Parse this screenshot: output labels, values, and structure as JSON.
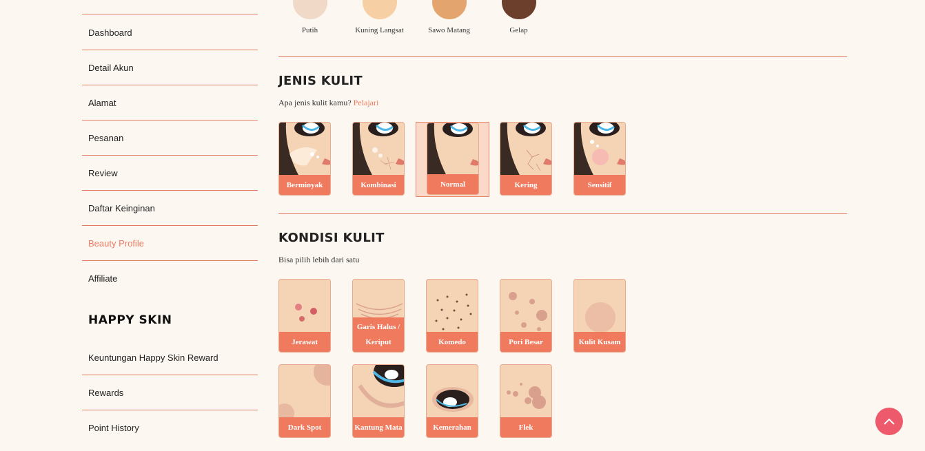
{
  "sidebar": {
    "items": [
      "Dashboard",
      "Detail Akun",
      "Alamat",
      "Pesanan",
      "Review",
      "Daftar Keinginan",
      "Beauty Profile",
      "Affiliate"
    ],
    "active": "Beauty Profile",
    "happy_skin": {
      "heading": "HAPPY SKIN",
      "items": [
        "Keuntungan Happy Skin Reward",
        "Rewards",
        "Point History"
      ]
    }
  },
  "skin_tone": {
    "options": [
      {
        "label": "Putih",
        "color": "#f0d9c6"
      },
      {
        "label": "Kuning Langsat",
        "color": "#f7cfa5"
      },
      {
        "label": "Sawo Matang",
        "color": "#e3a46e"
      },
      {
        "label": "Gelap",
        "color": "#6b3f2c"
      }
    ]
  },
  "jenis_kulit": {
    "title": "JENIS KULIT",
    "question": "Apa jenis kulit kamu?",
    "link": "Pelajari",
    "options": [
      "Berminyak",
      "Kombinasi",
      "Normal",
      "Kering",
      "Sensitif"
    ],
    "selected": "Normal"
  },
  "kondisi_kulit": {
    "title": "KONDISI KULIT",
    "subtitle": "Bisa pilih lebih dari satu",
    "options": [
      "Jerawat",
      "Garis Halus / Keriput",
      "Komedo",
      "Pori Besar",
      "Kulit Kusam",
      "Dark Spot",
      "Kantung Mata",
      "Kemerahan",
      "Flek"
    ]
  },
  "colors": {
    "accent": "#ef7b63",
    "background": "#fcf7f0",
    "scroll_button": "#ec5a6c"
  }
}
